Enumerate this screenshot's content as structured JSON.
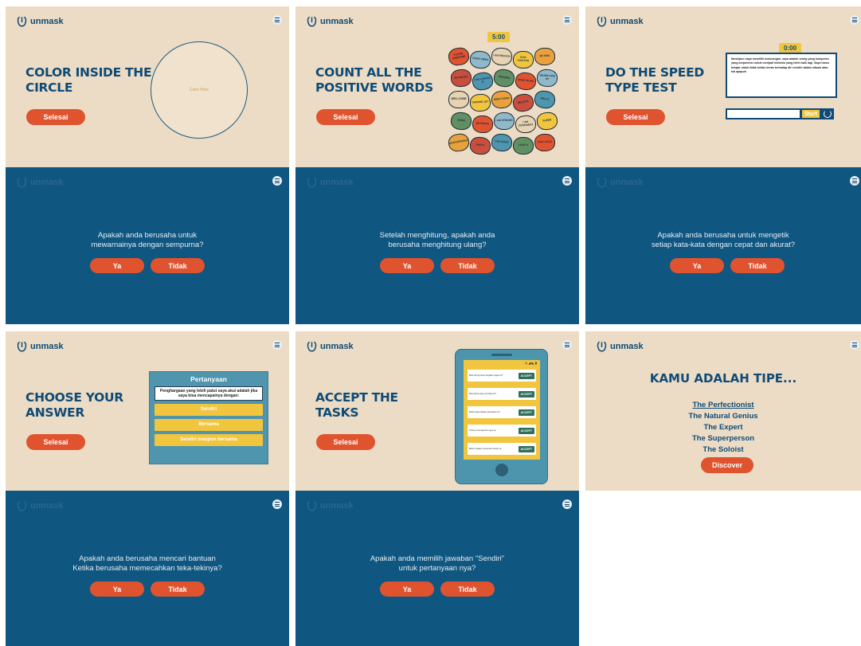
{
  "brand": {
    "name": "unmask"
  },
  "common": {
    "selesai": "Selesai",
    "ya": "Ya",
    "tidak": "Tidak"
  },
  "panel1": {
    "title": "COLOR INSIDE THE CIRCLE",
    "circle_label": "Color Here",
    "question": "Apakah anda berusaha untuk\nmewarnainya dengan sempurna?"
  },
  "panel2": {
    "title": "COUNT ALL THE POSITIVE WORDS",
    "timer": "5:00",
    "bubbles": [
      "YOU'RE AWESOME",
      "GOOD VIBES",
      "I AM ENOUGH",
      "STAY POSITIVE",
      "BE KIND",
      "SO PROUD",
      "YOU CAN DO IT",
      "AMAZING",
      "SMILE MORE",
      "NEVER GIVE UP",
      "WELL DONE",
      "CHOOSE JOY",
      "KEEP GOING",
      "BELIEVE",
      "HELLO",
      "SHINE",
      "BE BRAVE",
      "I AM STRONG",
      "I AM CONFIDENT",
      "SUPER",
      "UNSTOPPABLE",
      "HAPPY",
      "YOU ROCK",
      "LOVE IT",
      "STAY GOLD"
    ],
    "question": "Setelah menghitung, apakah anda\nberusaha menghitung ulang?"
  },
  "panel3": {
    "title": "DO THE SPEED TYPE TEST",
    "timer": "0:00",
    "paragraph": "Meskipun saya memiliki kekurangan, saya adalah orang yang kompeten yang berpotensi untuk menjadi individu yang lebih baik lagi. Saya harus belajar untuk tidak terlalu keras terhadap diri sendiri dalam situasi atau hal apapun",
    "start": "Start",
    "question": "Apakah anda berusaha untuk mengetik\nsetiap kata-kata dengan cepat dan akurat?"
  },
  "panel4": {
    "title": "CHOOSE YOUR ANSWER",
    "card_head": "Pertanyaan",
    "card_question": "Penghargaan yang lebih patut saya akui adalah jika saya bisa mencapainya dengan:",
    "options": [
      "Sendiri",
      "Bersama",
      "Sendiri maupun bersama"
    ],
    "question": "Apakah anda berusaha mencari bantuan\nKetika berusaha memecahkan teka-tekinya?"
  },
  "panel5": {
    "title": "ACCEPT THE TASKS",
    "status": "◎ ◢ ◣ ▮",
    "accept": "ACCEPT",
    "tasks": [
      "Bisa tolong bantu kerjakan tugas ini?",
      "Mau bantu saya cek data ini?",
      "Boleh saya titipkan pekerjaan ini?",
      "Tolong revisi laporan saya ya",
      "Bantu siapkan presentasi besok ya"
    ],
    "question": "Apakah anda memilih jawaban \"Sendiri\"\nuntuk pertanyaan nya?"
  },
  "panel6": {
    "title": "KAMU ADALAH TIPE...",
    "types": [
      "The Perfectionist",
      "The Natural Genius",
      "The Expert",
      "The Superperson",
      "The Soloist"
    ],
    "discover": "Discover"
  },
  "colors": {
    "beige": "#ecdcc5",
    "navy": "#0f5681",
    "orange": "#e0532f",
    "yellow": "#f2c53f",
    "teal": "#4e95ad"
  }
}
